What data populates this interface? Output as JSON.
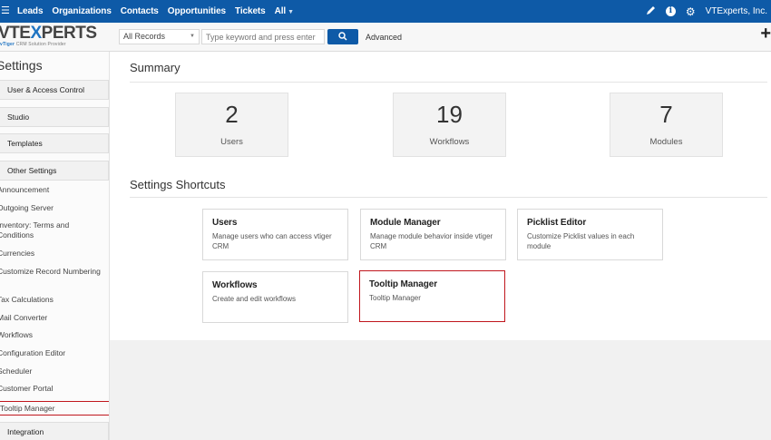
{
  "topnav": {
    "items": [
      {
        "label": "Leads"
      },
      {
        "label": "Organizations"
      },
      {
        "label": "Contacts"
      },
      {
        "label": "Opportunities"
      },
      {
        "label": "Tickets"
      },
      {
        "label": "All"
      }
    ],
    "company": "VTExperts, Inc.",
    "icons": [
      "pencil-icon",
      "info-icon",
      "gear-icon"
    ]
  },
  "logo": {
    "brand_pre": "VTE",
    "brand_x": "X",
    "brand_post": "PERTS",
    "tagline_bold": "vTiger",
    "tagline": " CRM Solution Provider"
  },
  "search": {
    "records_value": "All Records",
    "placeholder": "Type keyword and press enter",
    "advanced_label": "Advanced"
  },
  "sidebar": {
    "title": "Settings",
    "sections": {
      "user_access": "User & Access Control",
      "studio": "Studio",
      "templates": "Templates",
      "other_settings": "Other Settings",
      "integration": "Integration"
    },
    "links": [
      {
        "label": "Announcement"
      },
      {
        "label": "Outgoing Server"
      },
      {
        "label": "Inventory: Terms and Conditions"
      },
      {
        "label": "Currencies"
      },
      {
        "label": "Customize Record Numbering"
      },
      {
        "label": "Tax Calculations"
      },
      {
        "label": "Mail Converter"
      },
      {
        "label": "Workflows"
      },
      {
        "label": "Configuration Editor"
      },
      {
        "label": "Scheduler"
      },
      {
        "label": "Customer Portal"
      },
      {
        "label": "Tooltip Manager"
      }
    ]
  },
  "summary": {
    "title": "Summary",
    "stats": [
      {
        "value": "2",
        "label": "Users"
      },
      {
        "value": "19",
        "label": "Workflows"
      },
      {
        "value": "7",
        "label": "Modules"
      }
    ]
  },
  "shortcuts": {
    "title": "Settings Shortcuts",
    "items": [
      {
        "title": "Users",
        "desc": "Manage users who can access vtiger CRM"
      },
      {
        "title": "Module Manager",
        "desc": "Manage module behavior inside vtiger CRM"
      },
      {
        "title": "Picklist Editor",
        "desc": "Customize Picklist values in each module"
      },
      {
        "title": "Workflows",
        "desc": "Create and edit workflows"
      },
      {
        "title": "Tooltip Manager",
        "desc": "Tooltip Manager"
      }
    ]
  },
  "colors": {
    "topbar": "#0e5aa7",
    "highlight": "#c0161d",
    "brand_blue": "#1f74c2"
  }
}
